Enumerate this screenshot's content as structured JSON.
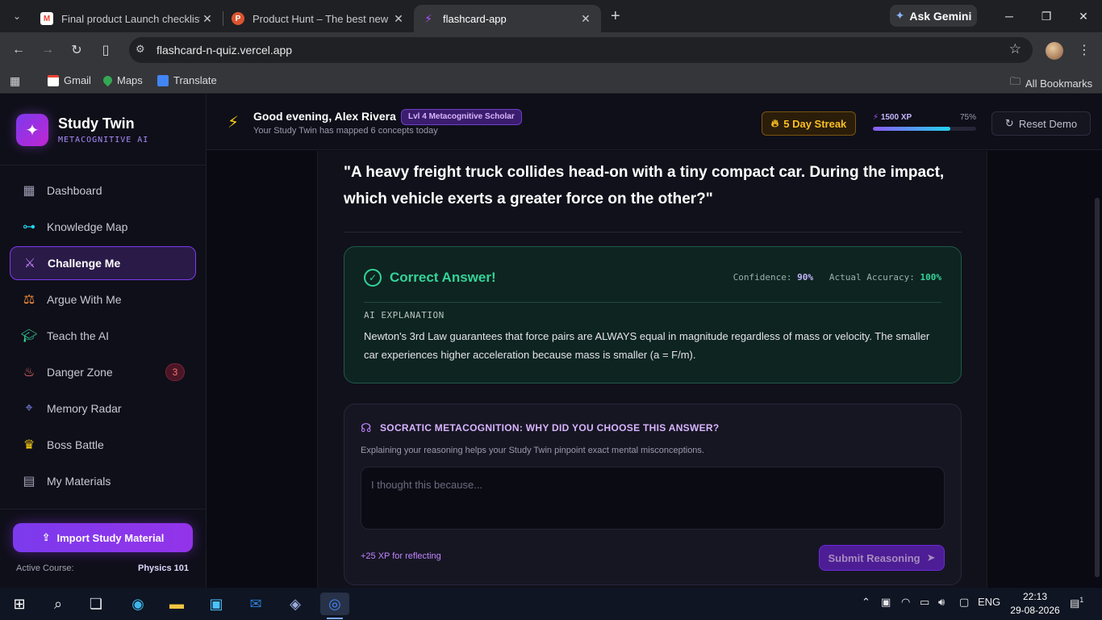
{
  "browser": {
    "tabs": [
      {
        "title": "Final product Launch checklist -",
        "favicon": "gmail-icon"
      },
      {
        "title": "Product Hunt – The best new p",
        "favicon": "producthunt-icon"
      },
      {
        "title": "flashcard-app",
        "favicon": "flashcard-icon",
        "active": true
      }
    ],
    "ask_gemini": "Ask Gemini",
    "url": "flashcard-n-quiz.vercel.app",
    "bookmarks": [
      {
        "label": "Gmail",
        "icon": "gmail-icon"
      },
      {
        "label": "Maps",
        "icon": "maps-icon"
      },
      {
        "label": "Translate",
        "icon": "translate-icon"
      }
    ],
    "all_bookmarks": "All Bookmarks"
  },
  "brand": {
    "title": "Study Twin",
    "subtitle": "METACOGNITIVE AI"
  },
  "sidebar": {
    "items": [
      {
        "label": "Dashboard",
        "icon": "grid-icon",
        "color": "#a0a0b8"
      },
      {
        "label": "Knowledge Map",
        "icon": "network-icon",
        "color": "#22d3ee"
      },
      {
        "label": "Challenge Me",
        "icon": "swords-icon",
        "color": "#c084fc",
        "active": true
      },
      {
        "label": "Argue With Me",
        "icon": "debate-icon",
        "color": "#fb923c"
      },
      {
        "label": "Teach the AI",
        "icon": "graduation-cap-icon",
        "color": "#34d399"
      },
      {
        "label": "Danger Zone",
        "icon": "flame-icon",
        "color": "#f87171",
        "badge": "3"
      },
      {
        "label": "Memory Radar",
        "icon": "radar-icon",
        "color": "#818cf8"
      },
      {
        "label": "Boss Battle",
        "icon": "trophy-icon",
        "color": "#facc15"
      },
      {
        "label": "My Materials",
        "icon": "folder-icon",
        "color": "#a0a0b8"
      }
    ],
    "import_label": "Import Study Material",
    "active_course_label": "Active Course:",
    "active_course_value": "Physics 101"
  },
  "header": {
    "greeting": "Good evening, Alex Rivera",
    "level_badge": "Lvl 4 Metacognitive Scholar",
    "mapped_text": "Your Study Twin has mapped 6 concepts today",
    "streak": "5 Day Streak",
    "xp": "1500 XP",
    "xp_percent_label": "75%",
    "xp_progress": 0.75,
    "reset_label": "Reset Demo"
  },
  "quiz": {
    "question": "\"A heavy freight truck collides head-on with a tiny compact car. During the impact, which vehicle exerts a greater force on the other?\"",
    "result_title": "Correct Answer!",
    "confidence_label": "Confidence:",
    "confidence_value": "90%",
    "accuracy_label": "Actual Accuracy:",
    "accuracy_value": "100%",
    "explanation_label": "AI EXPLANATION",
    "explanation": "Newton's 3rd Law guarantees that force pairs are ALWAYS equal in magnitude regardless of mass or velocity. The smaller car experiences higher acceleration because mass is smaller (a = F/m)."
  },
  "socratic": {
    "title": "SOCRATIC METACOGNITION: WHY DID YOU CHOOSE THIS ANSWER?",
    "description": "Explaining your reasoning helps your Study Twin pinpoint exact mental misconceptions.",
    "placeholder": "I thought this because...",
    "value": "",
    "xp_note": "+25 XP for reflecting",
    "submit_label": "Submit Reasoning"
  },
  "taskbar": {
    "lang": "ENG",
    "time": "22:13",
    "date": "29-08-2026",
    "notif_count": "1"
  }
}
